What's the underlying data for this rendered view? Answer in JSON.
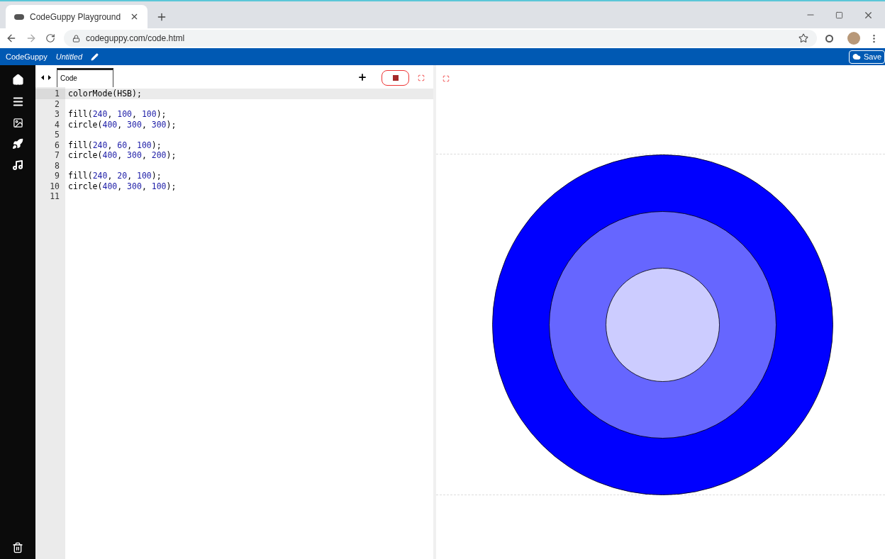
{
  "browser": {
    "tab_title": "CodeGuppy Playground",
    "url": "codeguppy.com/code.html"
  },
  "app_bar": {
    "brand": "CodeGuppy",
    "project": "Untitled",
    "save": "Save"
  },
  "editor": {
    "tabs": [
      {
        "label": "Code",
        "selected": true
      }
    ],
    "lines": [
      {
        "number": "1",
        "text": "colorMode(HSB);",
        "active": true
      },
      {
        "number": "2",
        "active": false
      },
      {
        "number": "3",
        "text": "fill(240, 100, 100);",
        "active": false
      },
      {
        "number": "4",
        "text": "circle(400, 300, 300);",
        "active": false
      },
      {
        "number": "5",
        "active": false
      },
      {
        "number": "6",
        "text": "fill(240, 60, 100);",
        "active": false
      },
      {
        "number": "7",
        "text": "circle(400, 300, 200);",
        "active": false
      },
      {
        "number": "8",
        "active": false
      },
      {
        "number": "9",
        "text": "fill(240, 20, 100);",
        "active": false
      },
      {
        "number": "10",
        "text": "circle(400, 300, 100);",
        "active": false
      },
      {
        "number": "11",
        "active": false
      }
    ]
  }
}
